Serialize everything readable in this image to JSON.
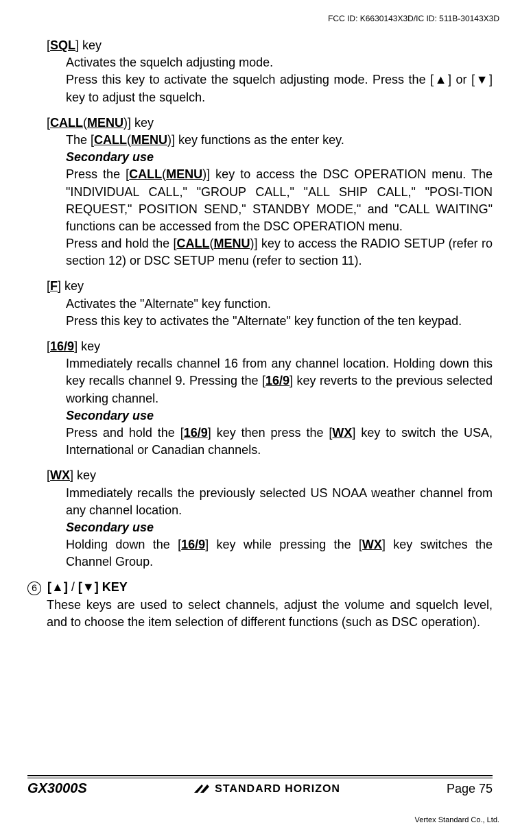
{
  "header": {
    "fccid": "FCC ID: K6630143X3D/IC ID: 511B-30143X3D"
  },
  "sql": {
    "title_open": "[",
    "title_key": "SQL",
    "title_close": "] key",
    "line1": "Activates the squelch adjusting mode.",
    "line2a": "Press this key to activate the squelch adjusting mode. Press the [",
    "up": "▲",
    "line2b": "] or [",
    "down": "▼",
    "line2c": "] key to adjust the squelch."
  },
  "call": {
    "title_open": "[",
    "title_key1": "CALL",
    "paren_open": "(",
    "title_key2": "MENU",
    "paren_close": ")",
    "title_close": "] key",
    "l1a": "The [",
    "l1b": "CALL",
    "l1c": "(",
    "l1d": "MENU",
    "l1e": ")] key functions as the enter key.",
    "sec_use": "Secondary use",
    "l2a": "Press the [",
    "l2b": "CALL",
    "l2c": "(",
    "l2d": "MENU",
    "l2e": ")] key to access the DSC OPERATION menu. The \"INDIVIDUAL CALL,\" \"GROUP CALL,\" \"ALL SHIP CALL,\" \"POSI-TION REQUEST,\" POSITION SEND,\" STANDBY MODE,\" and \"CALL WAITING\" functions can be accessed from the DSC OPERATION menu.",
    "l3a": "Press and hold the [",
    "l3b": "CALL",
    "l3c": "(",
    "l3d": "MENU",
    "l3e": ")] key to access the RADIO SETUP (refer ro section 12) or DSC SETUP menu (refer to section 11)."
  },
  "f": {
    "title_open": "[",
    "title_key": "F",
    "title_close": "] key",
    "l1": "Activates the \"Alternate\" key function.",
    "l2": "Press this key to activates the \"Alternate\" key function of the ten keypad."
  },
  "k169": {
    "title_open": "[",
    "title_key": "16/9",
    "title_close": "] key",
    "l1a": "Immediately recalls channel 16 from any channel location. Holding down this key recalls channel 9. Pressing the [",
    "l1b": "16/9",
    "l1c": "] key reverts to the previous selected working channel.",
    "sec_use": "Secondary use",
    "l2a": "Press and hold the [",
    "l2b": "16/9",
    "l2c": "] key then press the [",
    "l2d": "WX",
    "l2e": "] key to switch the USA, International or Canadian channels."
  },
  "wx": {
    "title_open": "[",
    "title_key": "WX",
    "title_close": "] key",
    "l1": "Immediately recalls the previously selected US NOAA weather channel from any channel location.",
    "sec_use": "Secondary use",
    "l2a": "Holding down the [",
    "l2b": "16/9",
    "l2c": "] key while pressing the [",
    "l2d": "WX",
    "l2e": "] key switches the Channel Group."
  },
  "sec6": {
    "num": "6",
    "open1": "[",
    "up": "▲",
    "close1": "]",
    "slash": " / ",
    "open2": "[",
    "down": "▼",
    "close2": "]",
    "keylabel": " KEY",
    "body": "These keys are used to select channels, adjust the volume and squelch level, and to choose the item selection of different functions (such as DSC operation)."
  },
  "footer": {
    "model": "GX3000S",
    "logo": "STANDARD HORIZON",
    "page": "Page 75",
    "company": "Vertex Standard Co., Ltd."
  }
}
